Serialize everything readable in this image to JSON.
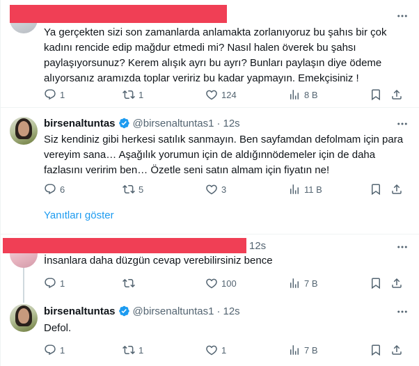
{
  "tweets": [
    {
      "id": "t1",
      "name": "",
      "handle": "",
      "time": "",
      "text": "Ya gerçekten sizi son zamanlarda anlamakta zorlanıyoruz bu şahıs bir çok kadını rencide edip mağdur etmedi mi? Nasıl halen överek bu şahsı paylaşıyorsunuz? Kerem alışık ayrı bu ayrı? Bunları paylaşın diye ödeme alıyorsanız aramızda toplar veririz bu kadar yapmayın. Emekçisiniz !",
      "actions": {
        "reply": "1",
        "retweet": "1",
        "like": "124",
        "views": "8 B"
      }
    },
    {
      "id": "t2",
      "name": "birsenaltuntas",
      "handle": "@birsenaltuntas1",
      "dot": "·",
      "time": "12s",
      "text": "Siz kendiniz gibi herkesi satılık sanmayın. Ben sayfamdan defolmam için para vereyim sana… Aşağılık yorumun için de aldığınnödemeler için de daha fazlasını veririm ben… Özetle seni satın almam için fiyatın ne!",
      "actions": {
        "reply": "6",
        "retweet": "5",
        "like": "3",
        "views": "11 B"
      }
    },
    {
      "id": "t3",
      "name": "",
      "handle": "",
      "dot": "·",
      "time": "12s",
      "text": "İnsanlara daha düzgün cevap verebilirsiniz bence",
      "actions": {
        "reply": "1",
        "retweet": "",
        "like": "100",
        "views": "7 B"
      }
    },
    {
      "id": "t4",
      "name": "birsenaltuntas",
      "handle": "@birsenaltuntas1",
      "dot": "·",
      "time": "12s",
      "text": "Defol.",
      "actions": {
        "reply": "1",
        "retweet": "1",
        "like": "1",
        "views": "7 B"
      }
    }
  ],
  "show_replies_label": "Yanıtları göster",
  "colors": {
    "redaction": "#f03f55",
    "accent": "#1d9bf0",
    "muted": "#536471"
  }
}
